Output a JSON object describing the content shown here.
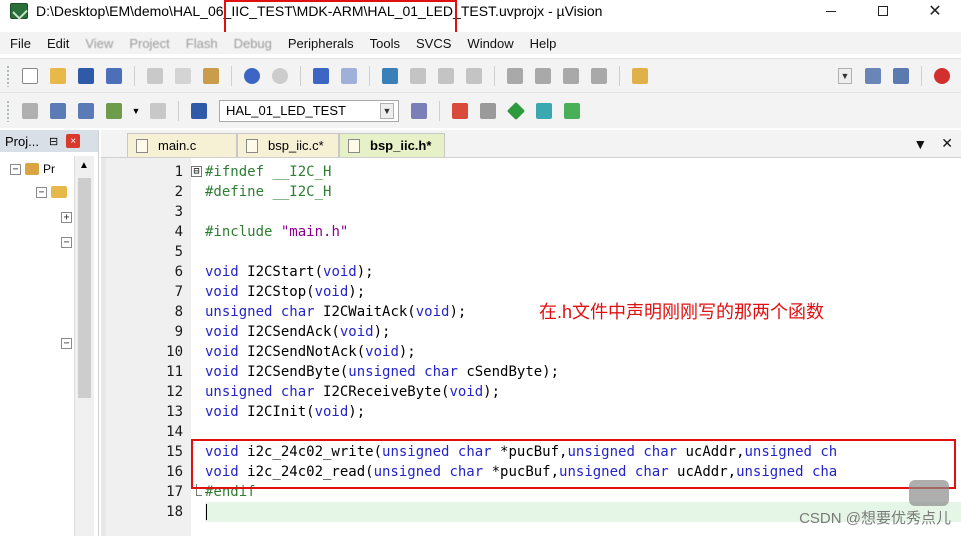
{
  "window": {
    "title": "D:\\Desktop\\EM\\demo\\HAL_06_IIC_TEST\\MDK-ARM\\HAL_01_LED_TEST.uvprojx - µVision",
    "minimize_symbol": "—",
    "maximize_symbol": "☐",
    "close_symbol": "✕"
  },
  "menu": {
    "items": [
      "File",
      "Edit",
      "View",
      "Project",
      "Flash",
      "Debug",
      "Peripherals",
      "Tools",
      "SVCS",
      "Window",
      "Help"
    ]
  },
  "toolbar2": {
    "target": "HAL_01_LED_TEST"
  },
  "project_panel": {
    "title": "Proj...",
    "pin_symbol": "⊟",
    "close_symbol": "×",
    "tree_root_label": "Pr"
  },
  "tabs": [
    {
      "label": "main.c",
      "active": false
    },
    {
      "label": "bsp_iic.c*",
      "active": false
    },
    {
      "label": "bsp_iic.h*",
      "active": true
    }
  ],
  "tabs_right": {
    "dropdown_symbol": "▼",
    "close_symbol": "✕"
  },
  "editor": {
    "lines": [
      {
        "n": "1",
        "fold": "⊟",
        "tokens": [
          {
            "t": "#ifndef",
            "c": "pp"
          },
          {
            "t": " __I2C_H",
            "c": "pp"
          }
        ]
      },
      {
        "n": "2",
        "tokens": [
          {
            "t": "#define",
            "c": "pp"
          },
          {
            "t": " __I2C_H",
            "c": "pp"
          }
        ]
      },
      {
        "n": "3",
        "tokens": []
      },
      {
        "n": "4",
        "tokens": [
          {
            "t": "#include",
            "c": "pp"
          },
          {
            "t": " \"main.h\"",
            "c": "str"
          }
        ]
      },
      {
        "n": "5",
        "tokens": []
      },
      {
        "n": "6",
        "tokens": [
          {
            "t": "void",
            "c": "kw"
          },
          {
            "t": " I2CStart(",
            "c": "plain"
          },
          {
            "t": "void",
            "c": "kw"
          },
          {
            "t": ");",
            "c": "plain"
          }
        ]
      },
      {
        "n": "7",
        "tokens": [
          {
            "t": "void",
            "c": "kw"
          },
          {
            "t": " I2CStop(",
            "c": "plain"
          },
          {
            "t": "void",
            "c": "kw"
          },
          {
            "t": ");",
            "c": "plain"
          }
        ]
      },
      {
        "n": "8",
        "tokens": [
          {
            "t": "unsigned",
            "c": "kw"
          },
          {
            "t": " ",
            "c": "plain"
          },
          {
            "t": "char",
            "c": "kw"
          },
          {
            "t": " I2CWaitAck(",
            "c": "plain"
          },
          {
            "t": "void",
            "c": "kw"
          },
          {
            "t": ");",
            "c": "plain"
          }
        ]
      },
      {
        "n": "9",
        "tokens": [
          {
            "t": "void",
            "c": "kw"
          },
          {
            "t": " I2CSendAck(",
            "c": "plain"
          },
          {
            "t": "void",
            "c": "kw"
          },
          {
            "t": ");",
            "c": "plain"
          }
        ]
      },
      {
        "n": "10",
        "tokens": [
          {
            "t": "void",
            "c": "kw"
          },
          {
            "t": " I2CSendNotAck(",
            "c": "plain"
          },
          {
            "t": "void",
            "c": "kw"
          },
          {
            "t": ");",
            "c": "plain"
          }
        ]
      },
      {
        "n": "11",
        "tokens": [
          {
            "t": "void",
            "c": "kw"
          },
          {
            "t": " I2CSendByte(",
            "c": "plain"
          },
          {
            "t": "unsigned",
            "c": "kw"
          },
          {
            "t": " ",
            "c": "plain"
          },
          {
            "t": "char",
            "c": "kw"
          },
          {
            "t": " cSendByte);",
            "c": "plain"
          }
        ]
      },
      {
        "n": "12",
        "tokens": [
          {
            "t": "unsigned",
            "c": "kw"
          },
          {
            "t": " ",
            "c": "plain"
          },
          {
            "t": "char",
            "c": "kw"
          },
          {
            "t": " I2CReceiveByte(",
            "c": "plain"
          },
          {
            "t": "void",
            "c": "kw"
          },
          {
            "t": ");",
            "c": "plain"
          }
        ]
      },
      {
        "n": "13",
        "tokens": [
          {
            "t": "void",
            "c": "kw"
          },
          {
            "t": " I2CInit(",
            "c": "plain"
          },
          {
            "t": "void",
            "c": "kw"
          },
          {
            "t": ");",
            "c": "plain"
          }
        ]
      },
      {
        "n": "14",
        "tokens": []
      },
      {
        "n": "15",
        "tokens": [
          {
            "t": "void",
            "c": "kw"
          },
          {
            "t": " i2c_24c02_write(",
            "c": "plain"
          },
          {
            "t": "unsigned",
            "c": "kw"
          },
          {
            "t": " ",
            "c": "plain"
          },
          {
            "t": "char",
            "c": "kw"
          },
          {
            "t": " *pucBuf,",
            "c": "plain"
          },
          {
            "t": "unsigned",
            "c": "kw"
          },
          {
            "t": " ",
            "c": "plain"
          },
          {
            "t": "char",
            "c": "kw"
          },
          {
            "t": " ucAddr,",
            "c": "plain"
          },
          {
            "t": "unsigned",
            "c": "kw"
          },
          {
            "t": " ",
            "c": "plain"
          },
          {
            "t": "ch",
            "c": "kw"
          }
        ]
      },
      {
        "n": "16",
        "tokens": [
          {
            "t": "void",
            "c": "kw"
          },
          {
            "t": " i2c_24c02_read(",
            "c": "plain"
          },
          {
            "t": "unsigned",
            "c": "kw"
          },
          {
            "t": " ",
            "c": "plain"
          },
          {
            "t": "char",
            "c": "kw"
          },
          {
            "t": " *pucBuf,",
            "c": "plain"
          },
          {
            "t": "unsigned",
            "c": "kw"
          },
          {
            "t": " ",
            "c": "plain"
          },
          {
            "t": "char",
            "c": "kw"
          },
          {
            "t": " ucAddr,",
            "c": "plain"
          },
          {
            "t": "unsigned",
            "c": "kw"
          },
          {
            "t": " ",
            "c": "plain"
          },
          {
            "t": "cha",
            "c": "kw"
          }
        ]
      },
      {
        "n": "17",
        "fold_end": true,
        "tokens": [
          {
            "t": "#endif",
            "c": "pp"
          }
        ]
      },
      {
        "n": "18",
        "current": true,
        "tokens": []
      }
    ]
  },
  "annotation_text": "在.h文件中声明刚刚写的那两个函数",
  "watermark": "CSDN @想要优秀点儿",
  "colors": {
    "keyword": "#2424c8",
    "preprocessor": "#2e7d32",
    "string": "#8b008b",
    "annotation_red": "#e01010"
  }
}
